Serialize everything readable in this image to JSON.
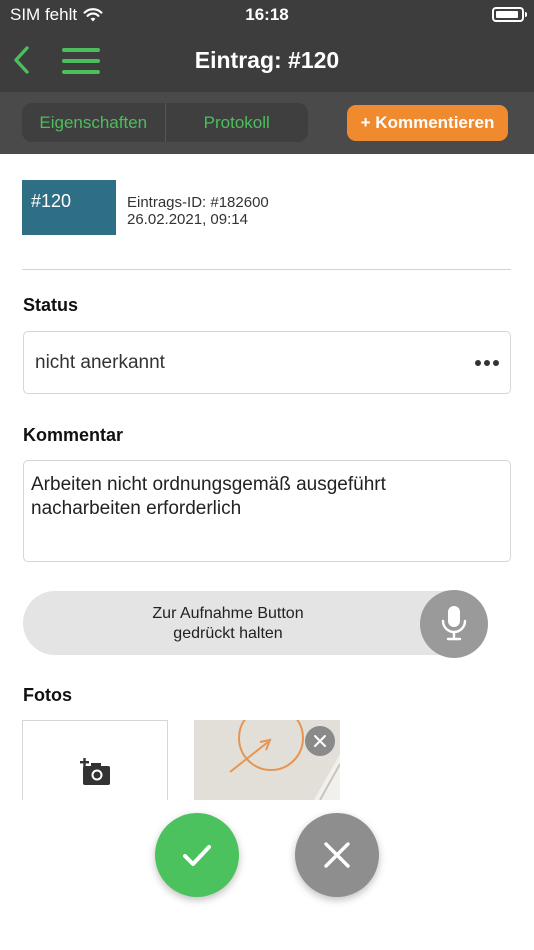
{
  "status_bar": {
    "carrier": "SIM fehlt",
    "time": "16:18",
    "icons": [
      "wifi-icon",
      "battery-icon"
    ]
  },
  "navbar": {
    "title": "Eintrag: #120",
    "icons": [
      "chevron-left-icon",
      "hamburger-menu-icon"
    ]
  },
  "tabs": [
    {
      "label": "Eigenschaften"
    },
    {
      "label": "Protokoll"
    }
  ],
  "actions": {
    "comment_label": "+ Kommentieren"
  },
  "entry": {
    "badge": "#120",
    "id_line": "Eintrags-ID: #182600",
    "date_line": "26.02.2021, 09:14"
  },
  "status": {
    "label": "Status",
    "value": "nicht anerkannt"
  },
  "comment": {
    "label": "Kommentar",
    "lines": [
      "Arbeiten nicht ordnungsgemäß ausgeführt",
      "nacharbeiten erforderlich"
    ]
  },
  "recording": {
    "lines": [
      "Zur Aufnahme Button",
      "gedrückt halten"
    ]
  },
  "photos": {
    "label": "Fotos",
    "count": 1
  },
  "colors": {
    "accent_green": "#4cbe5c",
    "accent_orange": "#ef8a2f",
    "badge_teal": "#2f6f86",
    "header_dark": "#3d3d3d"
  }
}
